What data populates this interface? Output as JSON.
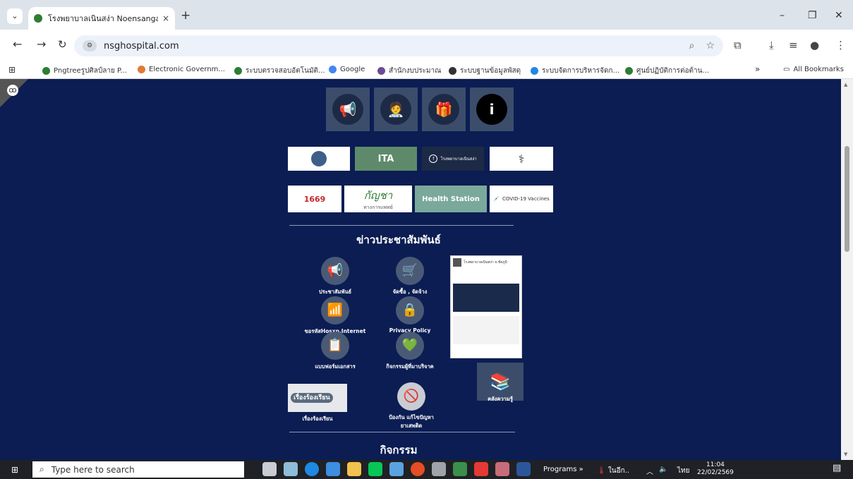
{
  "browser": {
    "tab_title": "โรงพยาบาลเนินสง่า Noensangaho",
    "tab_close": "×",
    "new_tab": "+",
    "url": "nsghospital.com",
    "window_min": "–",
    "window_max": "❐",
    "window_close": "✕"
  },
  "bookmarks": {
    "apps_icon": "apps-grid-icon",
    "items": [
      {
        "label": "Pngtreeรูปศิลป์ลาย P...",
        "color": "#2e7d32"
      },
      {
        "label": "Electronic Governm...",
        "color": "#e07b39"
      },
      {
        "label": "ระบบตรวจสอบอัตโนมัติ...",
        "color": "#2e7d32"
      },
      {
        "label": "Google",
        "color": "#4285f4"
      },
      {
        "label": "สำนักงบประมาณ",
        "color": "#6a4c93"
      },
      {
        "label": "ระบบฐานข้อมูลพัสดุ",
        "color": "#333333"
      },
      {
        "label": "ระบบจัดการบริหารจัดก...",
        "color": "#1e88e5"
      },
      {
        "label": "ศูนย์ปฏิบัติการต่อต้าน...",
        "color": "#2e7d32"
      }
    ],
    "overflow": "»",
    "all_bookmarks": "All Bookmarks"
  },
  "page": {
    "pr_section_title": "ข่าวประชาสัมพันธ์",
    "activity_section_title": "กิจกรรม",
    "top_icons": [
      "megaphone-icon",
      "doctor-icon",
      "gift-hand-icon",
      "info-icon"
    ],
    "banners_row1": [
      "",
      "ITA",
      "โรงพยาบาลเนินสง่า",
      ""
    ],
    "banners_row2": [
      "1669",
      "กัญชา",
      "Health Station",
      "COVID-19 Vaccines"
    ],
    "banner_row2_sub": "ทางการแพทย์",
    "services": [
      {
        "label": "ประชาสัมพันธ์",
        "icon": "megaphone-icon",
        "glyph": "📢"
      },
      {
        "label": "จัดซื้อ , จัดจ้าง",
        "icon": "cart-icon",
        "glyph": "🛒"
      },
      {
        "label": "ขอรหัสHosxp,Internet",
        "icon": "wifi-icon",
        "glyph": "📶"
      },
      {
        "label": "Privacy Policy",
        "icon": "lock-icon",
        "glyph": "🔒"
      },
      {
        "label": "แบบฟอร์มเอกสาร",
        "icon": "document-icon",
        "glyph": "📋"
      },
      {
        "label": "กิจกรรมผู้ที่มาบริจาค",
        "icon": "donate-heart-icon",
        "glyph": "💚"
      },
      {
        "label": "เรื่องร้องเรียน",
        "icon": "complaint-icon",
        "glyph": ""
      },
      {
        "label": "ป้องกัน แก้ไขปัญหายาเสพติด",
        "icon": "no-drugs-icon",
        "glyph": "🚫"
      },
      {
        "label": "คลังความรู้",
        "icon": "knowledge-icon",
        "glyph": "📚"
      }
    ],
    "complaint_banner_text": "เรื่องร้องเรียน",
    "fb_page_name": "โรงพยาบาลเนินสง่า จ.ชัยภูมิ"
  },
  "taskbar": {
    "search_placeholder": "Type here to search",
    "programs_label": "Programs",
    "weather": "ในอีก..",
    "lang": "ไทย",
    "time": "11:04",
    "date": "22/02/2569"
  }
}
